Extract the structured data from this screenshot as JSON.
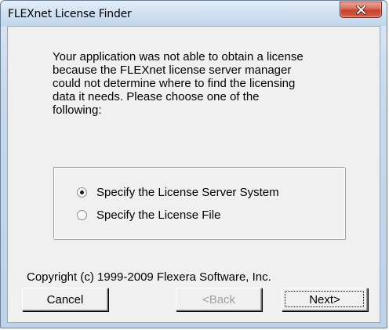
{
  "window": {
    "title": "FLEXnet License Finder"
  },
  "message": {
    "lines": [
      "Your application was not able to obtain a license",
      "because the FLEXnet license server manager",
      "could not determine where to find the licensing",
      "data it needs.  Please choose one of the",
      "following:"
    ]
  },
  "options": [
    {
      "label": "Specify the License Server System",
      "selected": true
    },
    {
      "label": "Specify the License File",
      "selected": false
    }
  ],
  "copyright": "Copyright (c) 1999-2009 Flexera Software, Inc.",
  "buttons": {
    "cancel_label": "Cancel",
    "back_label": "<Back",
    "next_label": "Next>"
  },
  "colors": {
    "close_button": "#c5432f",
    "client_background": "#f0f0f0",
    "disabled_text": "#a0a0a0"
  },
  "icons": {
    "close": "close-icon",
    "radio": "radio-button"
  }
}
